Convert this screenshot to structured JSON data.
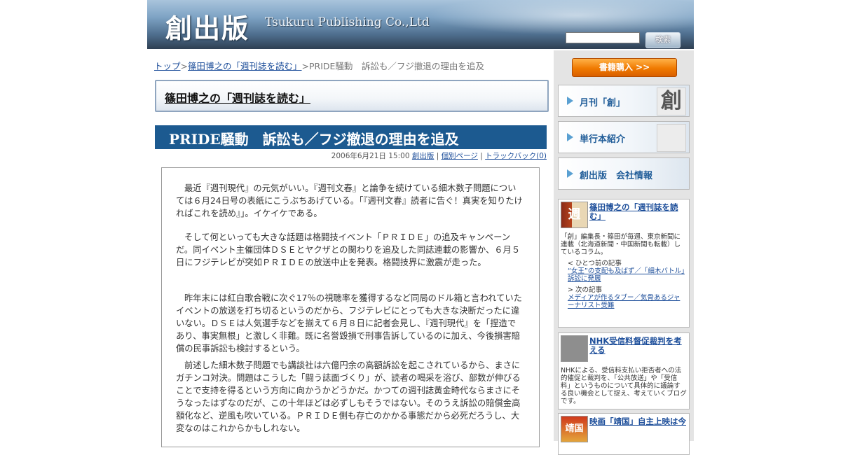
{
  "header": {
    "logo_jp": "創出版",
    "logo_en": "Tsukuru Publishing Co.,Ltd",
    "search_placeholder": "",
    "search_button": "検索"
  },
  "breadcrumb": {
    "top": "トップ",
    "sep1": ">",
    "series": "篠田博之の「週刊誌を読む」",
    "sep2": ">",
    "current": "PRIDE騒動　訴訟も／フジ撤退の理由を追及"
  },
  "series_title": "篠田博之の「週刊誌を読む」",
  "article": {
    "title": "PRIDE騒動　訴訟も／フジ撤退の理由を追及",
    "date": "2006年6月21日 15:00",
    "category": "創出版",
    "permalink": "個別ページ",
    "trackback": "トラックバック(0)",
    "meta_sep": "|",
    "paragraphs": [
      "最近『週刊現代』の元気がいい。『週刊文春』と論争を続けている細木数子問題については６月24日号の表紙にこうぶちあげている。「『週刊文春』読者に告ぐ！真実を知りたければこれを読め』」。イケイケである。",
      "そして何といっても大きな話題は格闘技イベント「ＰＲＩＤＥ」の追及キャンペーンだ。同イベント主催団体ＤＳＥとヤクザとの関わりを追及した同誌連載の影響か、６月５日にフジテレビが突如ＰＲＩＤＥの放送中止を発表。格闘技界に激震が走った。",
      "昨年末には紅白歌合戦に次ぐ17％の視聴率を獲得するなど同局のドル箱と言われていたイベントの放送を打ち切るというのだから、フジテレビにとっても大きな決断だったに違いない。ＤＳＥは人気選手などを揃えて６月８日に記者会見し、『週刊現代』を「捏造であり、事実無根」と激しく非難。既に名誉毀損で刑事告訴しているのに加え、今後損害賠償の民事訴訟も検討するという。",
      "前述した細木数子問題でも講談社は六億円余の高額訴訟を起こされているから、まさにガチンコ対決。問題はこうした「闘う誌面づくり」が、読者の喝采を浴び、部数が伸びることで支持を得るという方向に向かうかどうかだ。かつての週刊誌黄金時代ならまさにそうなったはずなのだが、この十年ほどは必ずしもそうではない。そのうえ訴訟の賠償金高額化など、逆風も吹いている。ＰＲＩＤＥ側も存亡のかかる事態だから必死だろうし、大変なのはこれからかもしれない。"
    ]
  },
  "sidebar": {
    "buy_button": "書籍購入 >>",
    "nav": [
      {
        "label": "月刊「創」",
        "thumb": "創"
      },
      {
        "label": "単行本紹介",
        "thumb": ""
      },
      {
        "label": "創出版　会社情報",
        "thumb": ""
      }
    ],
    "widgets": [
      {
        "title": "篠田博之の「週刊誌を読む」",
        "thumb_text": "週",
        "desc": "「創」編集長・篠田が毎週、東京新聞に連載（北海道新聞・中国新聞も転載）しているコラム。",
        "prev_label": "< ひとつ前の記事",
        "prev_link": "“女王”の支配も及ばず／「細木バトル」訴訟に発展",
        "next_label": "> 次の記事",
        "next_link": "メディアが作るタブー／気骨あるジャーナリスト受難"
      },
      {
        "title": "NHK受信料督促裁判を考える",
        "desc": "NHKによる、受信料支払い拒否者への法的催促と裁判を、「公共放送」や「受信料」というものについて具体的に議論する良い機会として捉え、考えていくブログです。"
      },
      {
        "title": "映画「靖国」自主上映は今",
        "thumb_text": "靖国"
      }
    ]
  }
}
